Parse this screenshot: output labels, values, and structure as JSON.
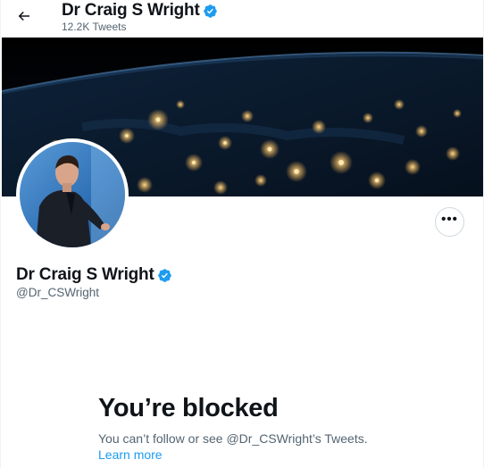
{
  "header": {
    "back_icon": "arrow-left-icon",
    "title": "Dr Craig S Wright",
    "tweet_count": "12.2K Tweets",
    "verified_icon": "verified-badge-icon"
  },
  "profile": {
    "name": "Dr Craig S Wright",
    "handle": "@Dr_CSWright",
    "more_icon": "more-options-icon",
    "more_label": "•••"
  },
  "blocked": {
    "title": "You’re blocked",
    "message": "You can’t follow or see @Dr_CSWright’s Tweets.",
    "link": "Learn more"
  },
  "colors": {
    "accent": "#1d9bf0",
    "text": "#0f1419",
    "secondary": "#536471",
    "border": "#cfd9de"
  }
}
